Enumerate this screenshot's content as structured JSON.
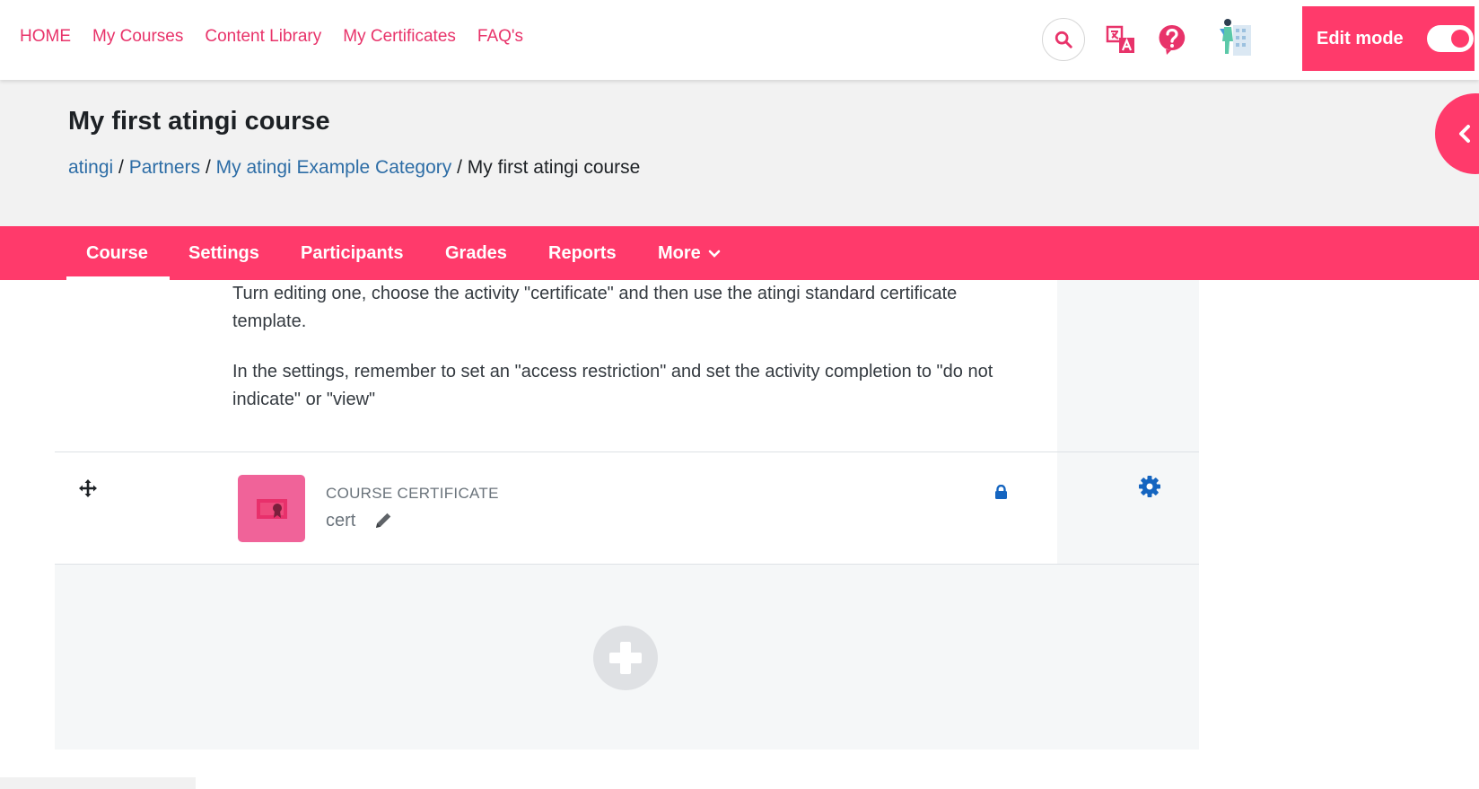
{
  "topnav": {
    "items": [
      "HOME",
      "My Courses",
      "Content Library",
      "My Certificates",
      "FAQ's"
    ]
  },
  "edit_mode": {
    "label": "Edit mode",
    "enabled": true
  },
  "header": {
    "title": "My first atingi course",
    "breadcrumb": [
      "atingi",
      "Partners",
      "My atingi Example Category",
      "My first atingi course"
    ],
    "separator": "/"
  },
  "secondary_nav": {
    "tabs": [
      "Course",
      "Settings",
      "Participants",
      "Grades",
      "Reports",
      "More"
    ],
    "active": "Course"
  },
  "section": {
    "paragraphs": [
      "Turn editing one, choose the activity \"certificate\" and then use the atingi standard certificate template.",
      "In the settings, remember to set an \"access restriction\" and set the activity completion to \"do not indicate\" or \"view\""
    ]
  },
  "activity": {
    "type_label": "COURSE CERTIFICATE",
    "name": "cert",
    "icon": "certificate-icon",
    "restricted": true
  },
  "colors": {
    "brand": "#ff3a6b",
    "link": "#2d6da6",
    "activity_icon_bg": "#f06399",
    "action_blue": "#1565c0"
  }
}
